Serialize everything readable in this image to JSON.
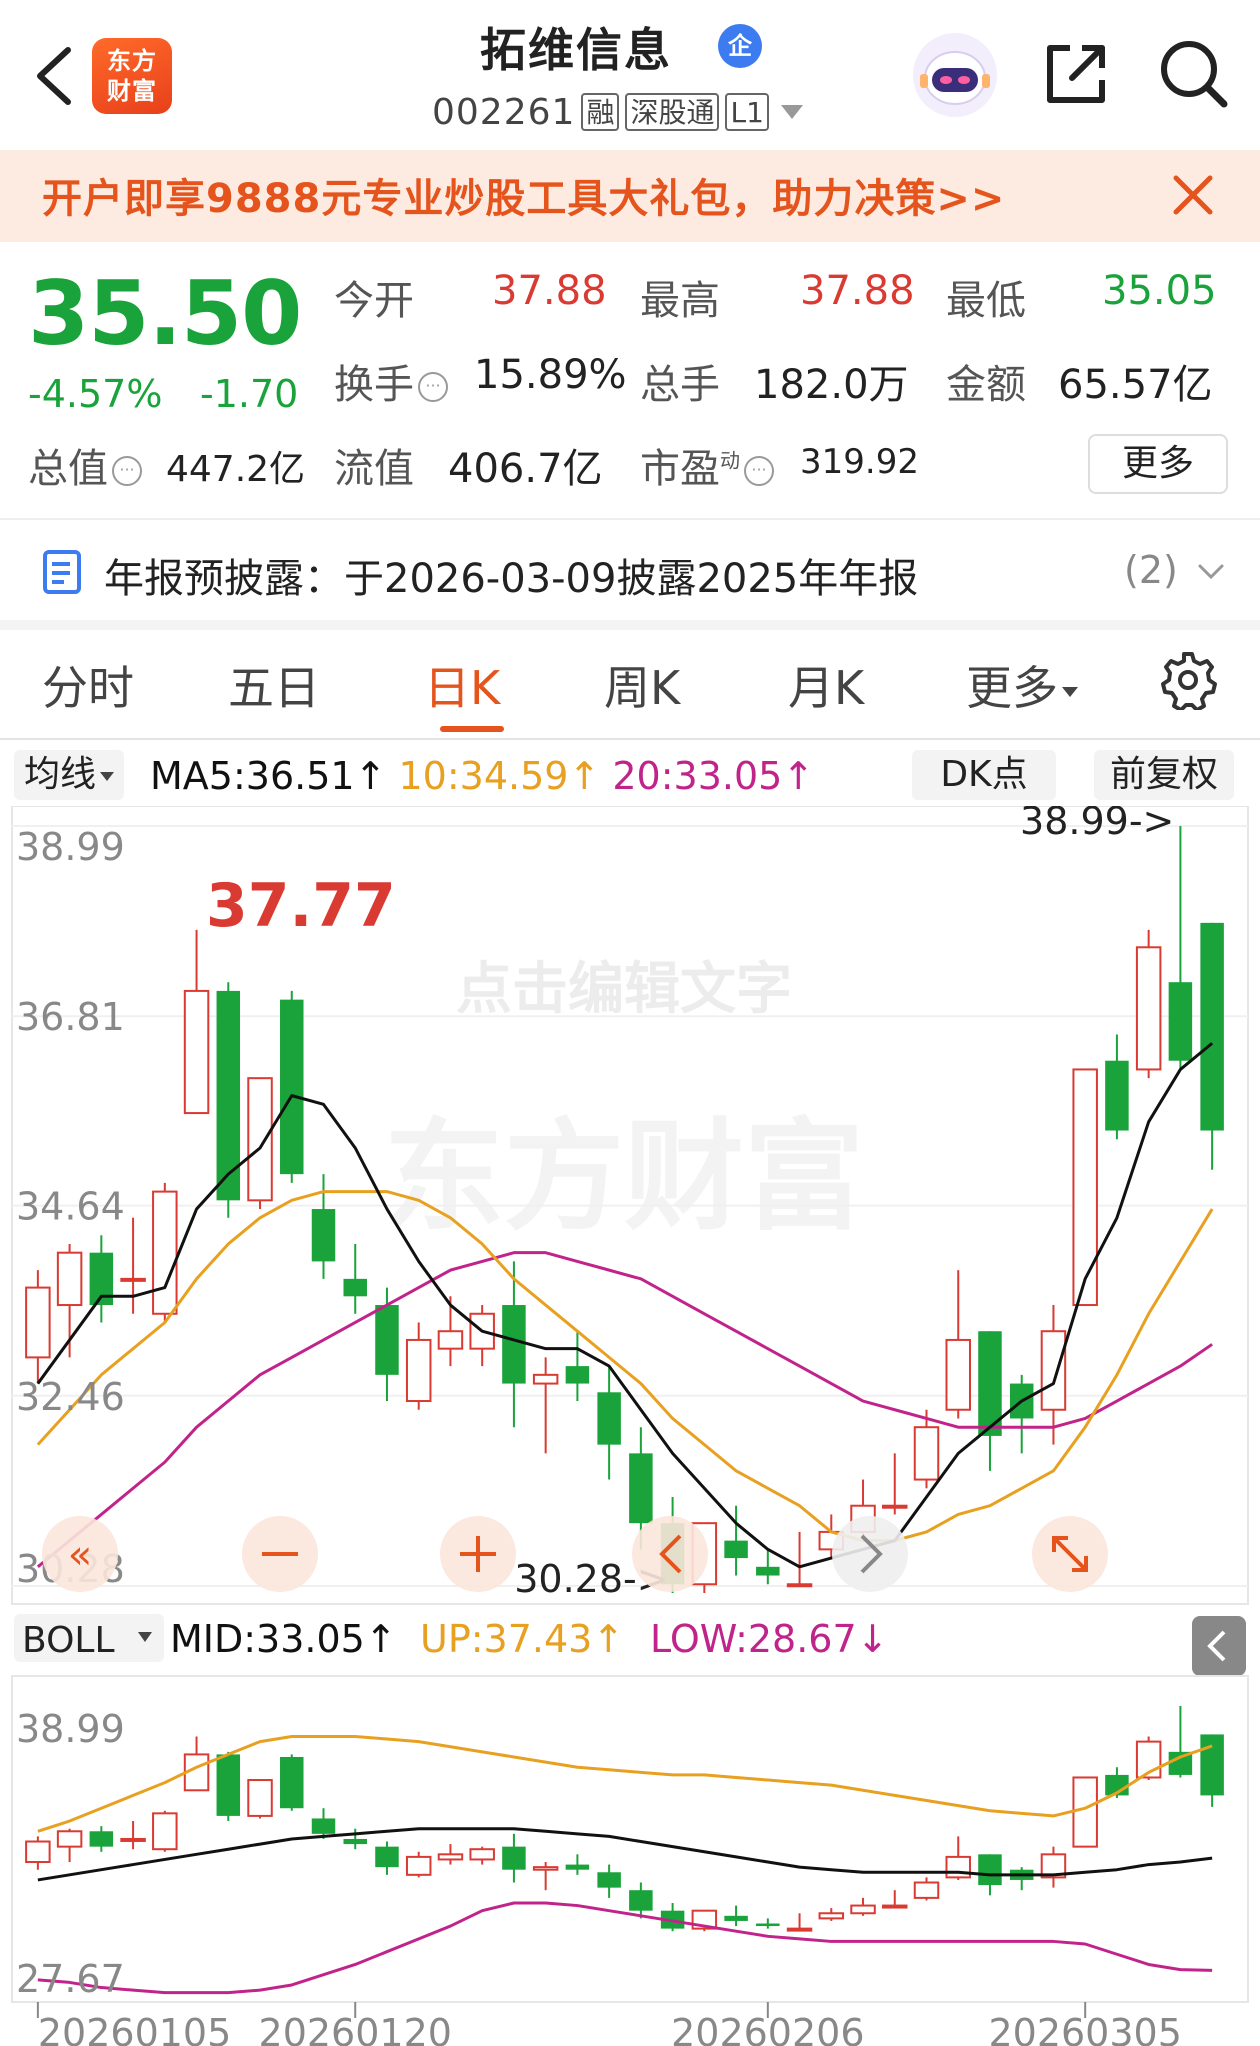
{
  "header": {
    "logo_line1": "东方",
    "logo_line2": "财富",
    "stock_name": "拓维信息",
    "qi_badge": "企",
    "stock_code": "002261",
    "tags": [
      "融",
      "深股通",
      "L1"
    ]
  },
  "promo": {
    "text": "开户即享9888元专业炒股工具大礼包，助力决策>>"
  },
  "quote": {
    "price": "35.50",
    "change_pct": "-4.57%",
    "change_abs": "-1.70",
    "open_label": "今开",
    "open": "37.88",
    "high_label": "最高",
    "high": "37.88",
    "low_label": "最低",
    "low": "35.05",
    "turnover_label": "换手",
    "turnover": "15.89%",
    "volume_label": "总手",
    "volume": "182.0万",
    "amount_label": "金额",
    "amount": "65.57亿",
    "mktcap_label": "总值",
    "mktcap": "447.2亿",
    "float_label": "流值",
    "float_cap": "406.7亿",
    "pe_label": "市盈",
    "pe_sup": "动",
    "pe": "319.92",
    "more_label": "更多"
  },
  "notice": {
    "text": "年报预披露：于2026-03-09披露2025年年报",
    "count": "(2)"
  },
  "tabs": [
    "分时",
    "五日",
    "日K",
    "周K",
    "月K",
    "更多"
  ],
  "active_tab": "日K",
  "indicator": {
    "select_label": "均线",
    "ma5": "MA5:36.51↑",
    "ma10": "10:34.59↑",
    "ma20": "20:33.05↑",
    "dk_label": "DK点",
    "fq_label": "前复权"
  },
  "boll": {
    "select_label": "BOLL",
    "mid": "MID:33.05↑",
    "up": "UP:37.43↑",
    "low": "LOW:28.67↓"
  },
  "colors": {
    "up": "#d93a32",
    "down": "#19a33a",
    "ma5": "#111111",
    "ma10": "#e8a020",
    "ma20": "#c0248a",
    "accent": "#e4541c"
  },
  "chart_data": {
    "type": "candlestick",
    "main": {
      "y_ticks": [
        "38.99",
        "36.81",
        "34.64",
        "32.46",
        "30.28"
      ],
      "ylim": [
        30.28,
        38.99
      ],
      "max_label": "37.77",
      "high_marker": "38.99->",
      "low_marker": "30.28->",
      "watermark_edit": "点击编辑文字",
      "watermark_brand": "东方财富",
      "candles": [
        [
          32.9,
          33.7,
          33.9,
          32.6
        ],
        [
          33.5,
          34.1,
          34.2,
          32.9
        ],
        [
          34.1,
          33.5,
          34.3,
          33.3
        ],
        [
          33.8,
          33.8,
          34.5,
          33.4
        ],
        [
          33.4,
          34.8,
          34.9,
          33.3
        ],
        [
          35.7,
          37.1,
          37.8,
          35.7
        ],
        [
          37.1,
          34.7,
          37.2,
          34.5
        ],
        [
          34.7,
          36.1,
          36.1,
          34.6
        ],
        [
          37.0,
          35.0,
          37.1,
          34.9
        ],
        [
          34.6,
          34.0,
          35.0,
          33.8
        ],
        [
          33.8,
          33.6,
          34.2,
          33.4
        ],
        [
          33.5,
          32.7,
          33.7,
          32.4
        ],
        [
          32.4,
          33.1,
          33.3,
          32.3
        ],
        [
          33.0,
          33.2,
          33.6,
          32.8
        ],
        [
          33.0,
          33.4,
          33.5,
          32.8
        ],
        [
          33.5,
          32.6,
          34.0,
          32.1
        ],
        [
          32.6,
          32.7,
          32.9,
          31.8
        ],
        [
          32.8,
          32.6,
          33.2,
          32.4
        ],
        [
          32.5,
          31.9,
          32.8,
          31.5
        ],
        [
          31.8,
          31.0,
          32.1,
          30.7
        ],
        [
          31.0,
          30.3,
          31.3,
          30.2
        ],
        [
          30.3,
          31.0,
          31.0,
          30.2
        ],
        [
          30.8,
          30.6,
          31.2,
          30.4
        ],
        [
          30.5,
          30.4,
          30.7,
          30.3
        ],
        [
          30.3,
          30.3,
          30.9,
          30.28
        ],
        [
          30.7,
          30.9,
          31.1,
          30.6
        ],
        [
          30.9,
          31.2,
          31.5,
          30.8
        ],
        [
          31.2,
          31.2,
          31.8,
          31.1
        ],
        [
          31.5,
          32.1,
          32.3,
          31.4
        ],
        [
          32.3,
          33.1,
          33.9,
          32.2
        ],
        [
          33.2,
          32.0,
          33.2,
          31.6
        ],
        [
          32.6,
          32.2,
          32.7,
          31.8
        ],
        [
          32.3,
          33.2,
          33.5,
          31.9
        ],
        [
          33.5,
          36.2,
          36.2,
          33.5
        ],
        [
          36.3,
          35.5,
          36.6,
          35.4
        ],
        [
          36.2,
          37.6,
          37.8,
          36.1
        ],
        [
          37.2,
          36.3,
          38.99,
          36.2
        ],
        [
          37.88,
          35.5,
          37.88,
          35.05
        ]
      ],
      "ma5": [
        32.6,
        33.1,
        33.6,
        33.6,
        33.7,
        34.6,
        35.0,
        35.3,
        35.9,
        35.8,
        35.3,
        34.6,
        34.0,
        33.5,
        33.2,
        33.1,
        33.0,
        33.0,
        32.8,
        32.3,
        31.8,
        31.4,
        31.0,
        30.7,
        30.5,
        30.6,
        30.7,
        30.8,
        31.3,
        31.8,
        32.1,
        32.4,
        32.6,
        33.8,
        34.5,
        35.6,
        36.2,
        36.5
      ],
      "ma10": [
        31.9,
        32.3,
        32.7,
        33.0,
        33.3,
        33.8,
        34.2,
        34.5,
        34.7,
        34.8,
        34.8,
        34.8,
        34.7,
        34.5,
        34.2,
        33.8,
        33.5,
        33.2,
        32.9,
        32.6,
        32.2,
        31.9,
        31.6,
        31.4,
        31.2,
        30.9,
        30.8,
        30.8,
        30.9,
        31.1,
        31.2,
        31.4,
        31.6,
        32.1,
        32.7,
        33.4,
        34.0,
        34.6
      ],
      "ma20": [
        30.5,
        30.8,
        31.1,
        31.4,
        31.7,
        32.1,
        32.4,
        32.7,
        32.9,
        33.1,
        33.3,
        33.5,
        33.7,
        33.9,
        34.0,
        34.1,
        34.1,
        34.0,
        33.9,
        33.8,
        33.6,
        33.4,
        33.2,
        33.0,
        32.8,
        32.6,
        32.4,
        32.3,
        32.2,
        32.1,
        32.1,
        32.1,
        32.1,
        32.2,
        32.4,
        32.6,
        32.8,
        33.05
      ]
    },
    "boll_panel": {
      "y_ticks": [
        "38.99",
        "27.67"
      ],
      "ylim": [
        27.67,
        38.99
      ],
      "mid": [
        32.2,
        32.4,
        32.6,
        32.8,
        33.0,
        33.2,
        33.4,
        33.6,
        33.8,
        33.9,
        34.0,
        34.1,
        34.2,
        34.2,
        34.2,
        34.2,
        34.1,
        34.0,
        33.9,
        33.7,
        33.5,
        33.3,
        33.1,
        32.9,
        32.7,
        32.6,
        32.5,
        32.5,
        32.5,
        32.5,
        32.4,
        32.4,
        32.4,
        32.5,
        32.6,
        32.8,
        32.9,
        33.05
      ],
      "up": [
        34.1,
        34.5,
        35.0,
        35.5,
        36.0,
        36.6,
        37.1,
        37.6,
        37.8,
        37.8,
        37.8,
        37.7,
        37.6,
        37.4,
        37.2,
        37.0,
        36.8,
        36.6,
        36.5,
        36.4,
        36.3,
        36.3,
        36.2,
        36.1,
        36.0,
        35.9,
        35.7,
        35.5,
        35.3,
        35.1,
        34.9,
        34.8,
        34.7,
        35.0,
        35.6,
        36.4,
        37.0,
        37.43
      ],
      "low": [
        28.3,
        28.2,
        28.0,
        27.9,
        27.8,
        27.8,
        27.8,
        27.9,
        28.1,
        28.5,
        28.9,
        29.4,
        29.9,
        30.4,
        31.0,
        31.3,
        31.3,
        31.2,
        31.0,
        30.8,
        30.6,
        30.4,
        30.2,
        30.0,
        29.9,
        29.8,
        29.8,
        29.8,
        29.8,
        29.8,
        29.8,
        29.8,
        29.8,
        29.7,
        29.3,
        28.9,
        28.7,
        28.67
      ]
    },
    "x_labels": [
      "20260105",
      "20260120",
      "20260206",
      "20260305"
    ]
  }
}
